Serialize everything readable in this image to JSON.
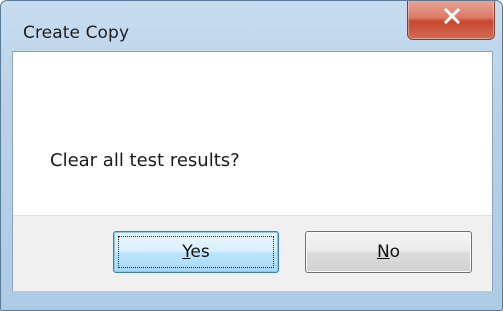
{
  "window": {
    "title": "Create Copy"
  },
  "dialog": {
    "message": "Clear all test results?"
  },
  "buttons": {
    "yes": {
      "mnemonic": "Y",
      "rest": "es"
    },
    "no": {
      "mnemonic": "N",
      "rest": "o"
    }
  },
  "icons": {
    "close": "close-icon"
  },
  "colors": {
    "close_button": "#d36b55",
    "title_bar": "#b9d1e8",
    "default_button_border": "#3c7fb1"
  }
}
